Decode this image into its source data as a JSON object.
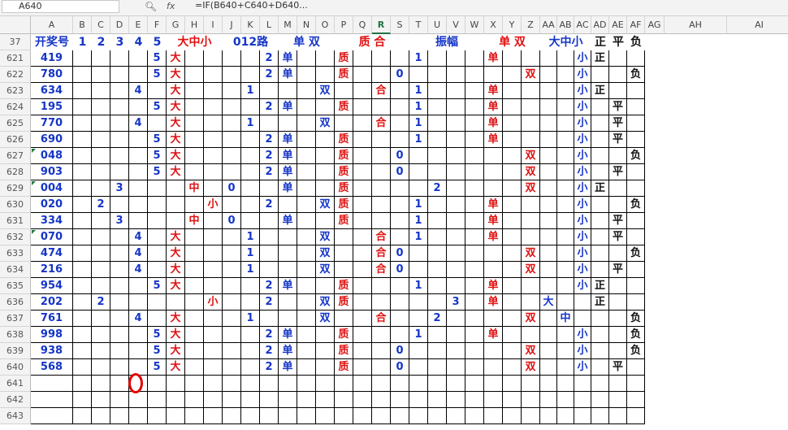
{
  "toolbar": {
    "name_box": "A640",
    "zoom_icon": "magnifier-icon",
    "fx_label": "fx",
    "formula": "=IF(B640+C640+D640..."
  },
  "columns": [
    "A",
    "B",
    "C",
    "D",
    "E",
    "F",
    "G",
    "H",
    "I",
    "J",
    "K",
    "L",
    "M",
    "N",
    "O",
    "P",
    "Q",
    "R",
    "S",
    "T",
    "U",
    "V",
    "W",
    "X",
    "Y",
    "Z",
    "AA",
    "AB",
    "AC",
    "AD",
    "AE",
    "AF",
    "AG",
    "AH",
    "AI"
  ],
  "active_column": "R",
  "header_row": {
    "row_num": "37",
    "items": [
      {
        "c": 0,
        "span": 1,
        "text": "开奖号",
        "color": "blue"
      },
      {
        "c": 1,
        "span": 1,
        "text": "1",
        "color": "blue"
      },
      {
        "c": 2,
        "span": 1,
        "text": "2",
        "color": "blue"
      },
      {
        "c": 3,
        "span": 1,
        "text": "3",
        "color": "blue"
      },
      {
        "c": 4,
        "span": 1,
        "text": "4",
        "color": "blue"
      },
      {
        "c": 5,
        "span": 1,
        "text": "5",
        "color": "blue"
      },
      {
        "c": 6,
        "span": 3,
        "text": "大中小",
        "color": "red"
      },
      {
        "c": 9,
        "span": 3,
        "text": "012路",
        "color": "blue"
      },
      {
        "c": 12,
        "span": 3,
        "text": "单 双",
        "color": "blue"
      },
      {
        "c": 15,
        "span": 4,
        "text": "质 合",
        "color": "red"
      },
      {
        "c": 19,
        "span": 4,
        "text": "振幅",
        "color": "blue"
      },
      {
        "c": 23,
        "span": 3,
        "text": "单 双",
        "color": "red"
      },
      {
        "c": 26,
        "span": 3,
        "text": "大中小",
        "color": "blue"
      },
      {
        "c": 29,
        "span": 1,
        "text": "正",
        "color": "black"
      },
      {
        "c": 30,
        "span": 1,
        "text": "平",
        "color": "black"
      },
      {
        "c": 31,
        "span": 1,
        "text": "负",
        "color": "black"
      }
    ]
  },
  "rows": [
    {
      "n": "621",
      "cells": [
        [
          0,
          "419"
        ],
        [
          5,
          "5"
        ],
        [
          6,
          "大"
        ],
        [
          11,
          "2"
        ],
        [
          12,
          "单"
        ],
        [
          15,
          "质"
        ],
        [
          19,
          "1"
        ],
        [
          23,
          "单"
        ],
        [
          28,
          "小"
        ],
        [
          29,
          "正"
        ]
      ]
    },
    {
      "n": "622",
      "cells": [
        [
          0,
          "780"
        ],
        [
          5,
          "5"
        ],
        [
          6,
          "大"
        ],
        [
          11,
          "2"
        ],
        [
          12,
          "单"
        ],
        [
          15,
          "质"
        ],
        [
          18,
          "0"
        ],
        [
          25,
          "双"
        ],
        [
          28,
          "小"
        ],
        [
          31,
          "负"
        ]
      ]
    },
    {
      "n": "623",
      "cells": [
        [
          0,
          "634"
        ],
        [
          4,
          "4"
        ],
        [
          6,
          "大"
        ],
        [
          10,
          "1"
        ],
        [
          14,
          "双"
        ],
        [
          17,
          "合"
        ],
        [
          19,
          "1"
        ],
        [
          23,
          "单"
        ],
        [
          28,
          "小"
        ],
        [
          29,
          "正"
        ]
      ]
    },
    {
      "n": "624",
      "cells": [
        [
          0,
          "195"
        ],
        [
          5,
          "5"
        ],
        [
          6,
          "大"
        ],
        [
          11,
          "2"
        ],
        [
          12,
          "单"
        ],
        [
          15,
          "质"
        ],
        [
          19,
          "1"
        ],
        [
          23,
          "单"
        ],
        [
          28,
          "小"
        ],
        [
          30,
          "平"
        ]
      ]
    },
    {
      "n": "625",
      "cells": [
        [
          0,
          "770"
        ],
        [
          4,
          "4"
        ],
        [
          6,
          "大"
        ],
        [
          10,
          "1"
        ],
        [
          14,
          "双"
        ],
        [
          17,
          "合"
        ],
        [
          19,
          "1"
        ],
        [
          23,
          "单"
        ],
        [
          28,
          "小"
        ],
        [
          30,
          "平"
        ]
      ]
    },
    {
      "n": "626",
      "cells": [
        [
          0,
          "690"
        ],
        [
          5,
          "5"
        ],
        [
          6,
          "大"
        ],
        [
          11,
          "2"
        ],
        [
          12,
          "单"
        ],
        [
          15,
          "质"
        ],
        [
          19,
          "1"
        ],
        [
          23,
          "单"
        ],
        [
          28,
          "小"
        ],
        [
          30,
          "平"
        ]
      ]
    },
    {
      "n": "627",
      "cells": [
        [
          0,
          "048"
        ],
        [
          5,
          "5"
        ],
        [
          6,
          "大"
        ],
        [
          11,
          "2"
        ],
        [
          12,
          "单"
        ],
        [
          15,
          "质"
        ],
        [
          18,
          "0"
        ],
        [
          25,
          "双"
        ],
        [
          28,
          "小"
        ],
        [
          31,
          "负"
        ]
      ]
    },
    {
      "n": "628",
      "cells": [
        [
          0,
          "903"
        ],
        [
          5,
          "5"
        ],
        [
          6,
          "大"
        ],
        [
          11,
          "2"
        ],
        [
          12,
          "单"
        ],
        [
          15,
          "质"
        ],
        [
          18,
          "0"
        ],
        [
          25,
          "双"
        ],
        [
          28,
          "小"
        ],
        [
          30,
          "平"
        ]
      ]
    },
    {
      "n": "629",
      "cells": [
        [
          0,
          "004"
        ],
        [
          3,
          "3"
        ],
        [
          7,
          "中"
        ],
        [
          9,
          "0"
        ],
        [
          12,
          "单"
        ],
        [
          15,
          "质"
        ],
        [
          20,
          "2"
        ],
        [
          25,
          "双"
        ],
        [
          28,
          "小"
        ],
        [
          29,
          "正"
        ]
      ]
    },
    {
      "n": "630",
      "cells": [
        [
          0,
          "020"
        ],
        [
          2,
          "2"
        ],
        [
          8,
          "小"
        ],
        [
          11,
          "2"
        ],
        [
          14,
          "双"
        ],
        [
          15,
          "质"
        ],
        [
          19,
          "1"
        ],
        [
          23,
          "单"
        ],
        [
          28,
          "小"
        ],
        [
          31,
          "负"
        ]
      ]
    },
    {
      "n": "631",
      "cells": [
        [
          0,
          "334"
        ],
        [
          3,
          "3"
        ],
        [
          7,
          "中"
        ],
        [
          9,
          "0"
        ],
        [
          12,
          "单"
        ],
        [
          15,
          "质"
        ],
        [
          19,
          "1"
        ],
        [
          23,
          "单"
        ],
        [
          28,
          "小"
        ],
        [
          30,
          "平"
        ]
      ]
    },
    {
      "n": "632",
      "cells": [
        [
          0,
          "070"
        ],
        [
          4,
          "4"
        ],
        [
          6,
          "大"
        ],
        [
          10,
          "1"
        ],
        [
          14,
          "双"
        ],
        [
          17,
          "合"
        ],
        [
          19,
          "1"
        ],
        [
          23,
          "单"
        ],
        [
          28,
          "小"
        ],
        [
          30,
          "平"
        ]
      ]
    },
    {
      "n": "633",
      "cells": [
        [
          0,
          "474"
        ],
        [
          4,
          "4"
        ],
        [
          6,
          "大"
        ],
        [
          10,
          "1"
        ],
        [
          14,
          "双"
        ],
        [
          17,
          "合"
        ],
        [
          18,
          "0"
        ],
        [
          25,
          "双"
        ],
        [
          28,
          "小"
        ],
        [
          31,
          "负"
        ]
      ]
    },
    {
      "n": "634",
      "cells": [
        [
          0,
          "216"
        ],
        [
          4,
          "4"
        ],
        [
          6,
          "大"
        ],
        [
          10,
          "1"
        ],
        [
          14,
          "双"
        ],
        [
          17,
          "合"
        ],
        [
          18,
          "0"
        ],
        [
          25,
          "双"
        ],
        [
          28,
          "小"
        ],
        [
          30,
          "平"
        ]
      ]
    },
    {
      "n": "635",
      "cells": [
        [
          0,
          "954"
        ],
        [
          5,
          "5"
        ],
        [
          6,
          "大"
        ],
        [
          11,
          "2"
        ],
        [
          12,
          "单"
        ],
        [
          15,
          "质"
        ],
        [
          19,
          "1"
        ],
        [
          23,
          "单"
        ],
        [
          28,
          "小"
        ],
        [
          29,
          "正"
        ]
      ]
    },
    {
      "n": "636",
      "cells": [
        [
          0,
          "202"
        ],
        [
          2,
          "2"
        ],
        [
          8,
          "小"
        ],
        [
          11,
          "2"
        ],
        [
          14,
          "双"
        ],
        [
          15,
          "质"
        ],
        [
          21,
          "3"
        ],
        [
          23,
          "单"
        ],
        [
          26,
          "大"
        ],
        [
          29,
          "正"
        ]
      ]
    },
    {
      "n": "637",
      "cells": [
        [
          0,
          "761"
        ],
        [
          4,
          "4"
        ],
        [
          6,
          "大"
        ],
        [
          10,
          "1"
        ],
        [
          14,
          "双"
        ],
        [
          17,
          "合"
        ],
        [
          20,
          "2"
        ],
        [
          25,
          "双"
        ],
        [
          27,
          "中"
        ],
        [
          31,
          "负"
        ]
      ]
    },
    {
      "n": "638",
      "cells": [
        [
          0,
          "998"
        ],
        [
          5,
          "5"
        ],
        [
          6,
          "大"
        ],
        [
          11,
          "2"
        ],
        [
          12,
          "单"
        ],
        [
          15,
          "质"
        ],
        [
          19,
          "1"
        ],
        [
          23,
          "单"
        ],
        [
          28,
          "小"
        ],
        [
          31,
          "负"
        ]
      ]
    },
    {
      "n": "639",
      "cells": [
        [
          0,
          "938"
        ],
        [
          5,
          "5"
        ],
        [
          6,
          "大"
        ],
        [
          11,
          "2"
        ],
        [
          12,
          "单"
        ],
        [
          15,
          "质"
        ],
        [
          18,
          "0"
        ],
        [
          25,
          "双"
        ],
        [
          28,
          "小"
        ],
        [
          31,
          "负"
        ]
      ]
    },
    {
      "n": "640",
      "cells": [
        [
          0,
          "568"
        ],
        [
          5,
          "5"
        ],
        [
          6,
          "大"
        ],
        [
          11,
          "2"
        ],
        [
          12,
          "单"
        ],
        [
          15,
          "质"
        ],
        [
          18,
          "0"
        ],
        [
          25,
          "双"
        ],
        [
          28,
          "小"
        ],
        [
          30,
          "平"
        ]
      ]
    },
    {
      "n": "641",
      "cells": []
    },
    {
      "n": "642",
      "cells": []
    },
    {
      "n": "643",
      "cells": []
    }
  ],
  "colors": {
    "blue": "#1535c8",
    "red": "#e01010",
    "black": "#111111",
    "highlight_circle": "#e10000"
  }
}
